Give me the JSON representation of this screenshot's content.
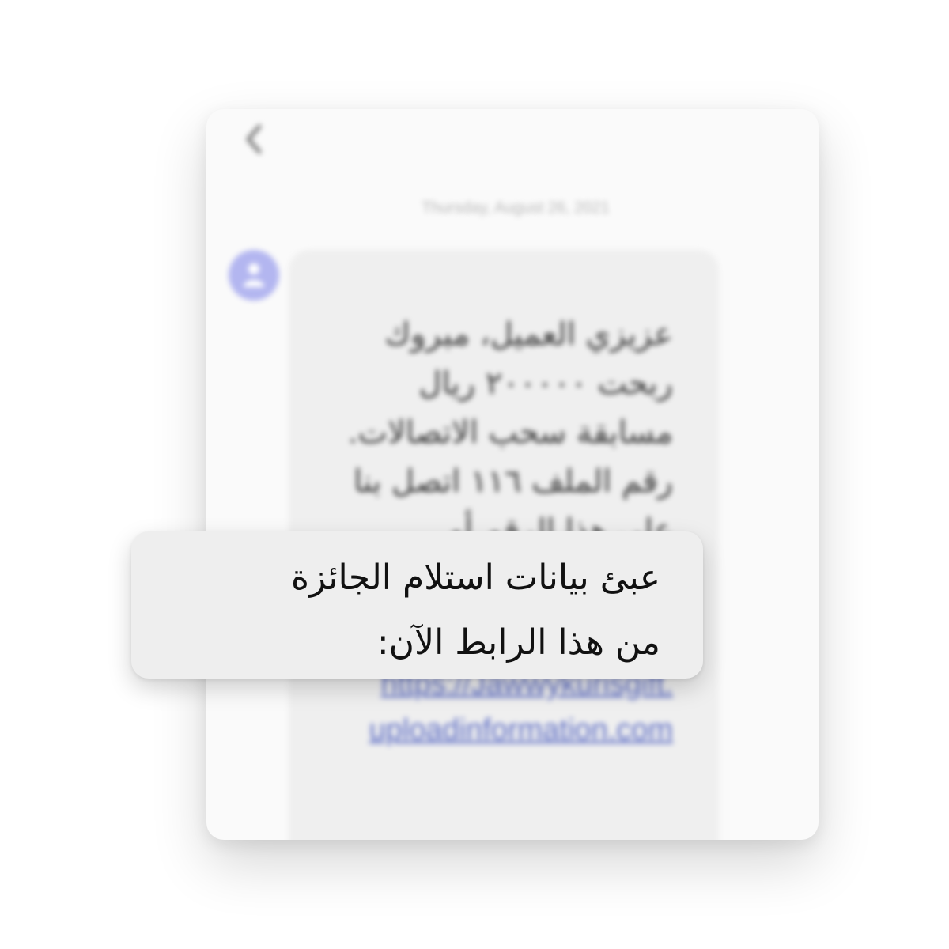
{
  "header": {
    "back_icon": "chevron-left-icon"
  },
  "conversation": {
    "date": "Thursday, August 26, 2021",
    "sender_avatar_icon": "person-icon",
    "avatar_color": "#b3b6f0",
    "message": {
      "lines": [
        "عزيزي العميل، مبروك",
        "ربحت ٢٠٠٠٠٠ ريال",
        "مسابقة سحب الاتصالات.",
        "رقم الملف ١١٦ اتصل بنا",
        "على هذا الرقم أو"
      ],
      "link_lines": [
        "https://Jawwykurisgift.",
        "uploadinformation.com"
      ],
      "link_color": "#5c6cc4"
    }
  },
  "callout": {
    "lines": [
      "عبئ بيانات استلام الجائزة",
      "من هذا الرابط الآن:"
    ]
  }
}
